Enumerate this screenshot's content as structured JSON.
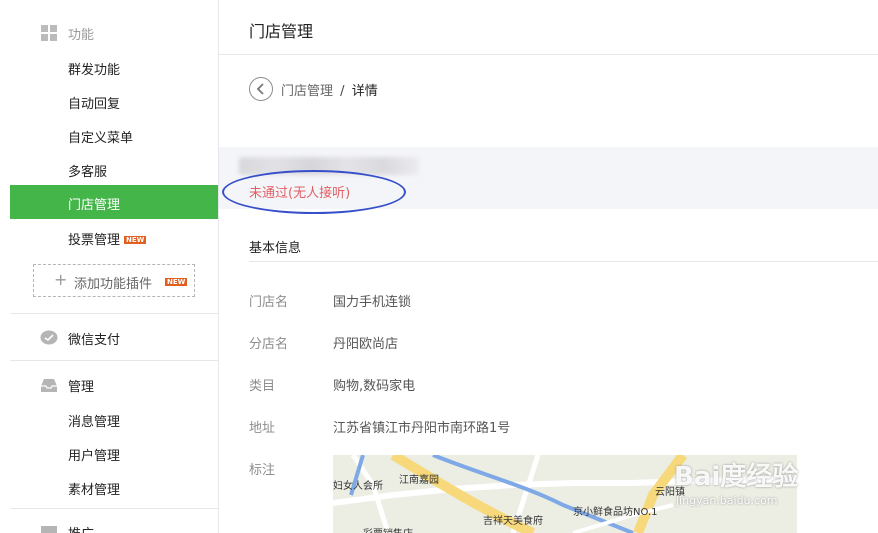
{
  "sidebar": {
    "groups": [
      {
        "title": "功能",
        "icon": "grid-icon"
      },
      {
        "title": "微信支付",
        "icon": "wechat-pay-icon"
      },
      {
        "title": "管理",
        "icon": "inbox-icon"
      },
      {
        "title": "推广",
        "icon": "promote-icon"
      }
    ],
    "function_items": [
      {
        "label": "群发功能"
      },
      {
        "label": "自动回复"
      },
      {
        "label": "自定义菜单"
      },
      {
        "label": "多客服"
      },
      {
        "label": "门店管理",
        "active": true
      },
      {
        "label": "投票管理",
        "badge": "NEW"
      }
    ],
    "add_plugin": {
      "label": "添加功能插件",
      "badge": "NEW"
    },
    "manage_items": [
      {
        "label": "消息管理"
      },
      {
        "label": "用户管理"
      },
      {
        "label": "素材管理"
      }
    ]
  },
  "main": {
    "title": "门店管理",
    "breadcrumb": {
      "parent": "门店管理",
      "separator": "/",
      "current": "详情"
    },
    "status": {
      "text": "未通过(无人接听)",
      "color": "#e15f63"
    },
    "section_title": "基本信息",
    "fields": [
      {
        "label": "门店名",
        "value": "国力手机连锁"
      },
      {
        "label": "分店名",
        "value": "丹阳欧尚店"
      },
      {
        "label": "类目",
        "value": "购物,数码家电"
      },
      {
        "label": "地址",
        "value": "江苏省镇江市丹阳市南环路1号"
      },
      {
        "label": "标注",
        "value": ""
      }
    ],
    "map": {
      "labels": [
        "江南嘉园",
        "云阳镇",
        "吉祥天美食府",
        "京小鲜食品坊NO.1",
        "彩票销售店",
        "妇女人会所"
      ]
    }
  },
  "watermark": {
    "brand": "Bai度经验",
    "url": "jingyan.baidu.com"
  },
  "colors": {
    "accent": "#44b549",
    "status_error": "#e15f63",
    "annotation_ring": "#3750c9",
    "badge": "#e15f1f"
  }
}
